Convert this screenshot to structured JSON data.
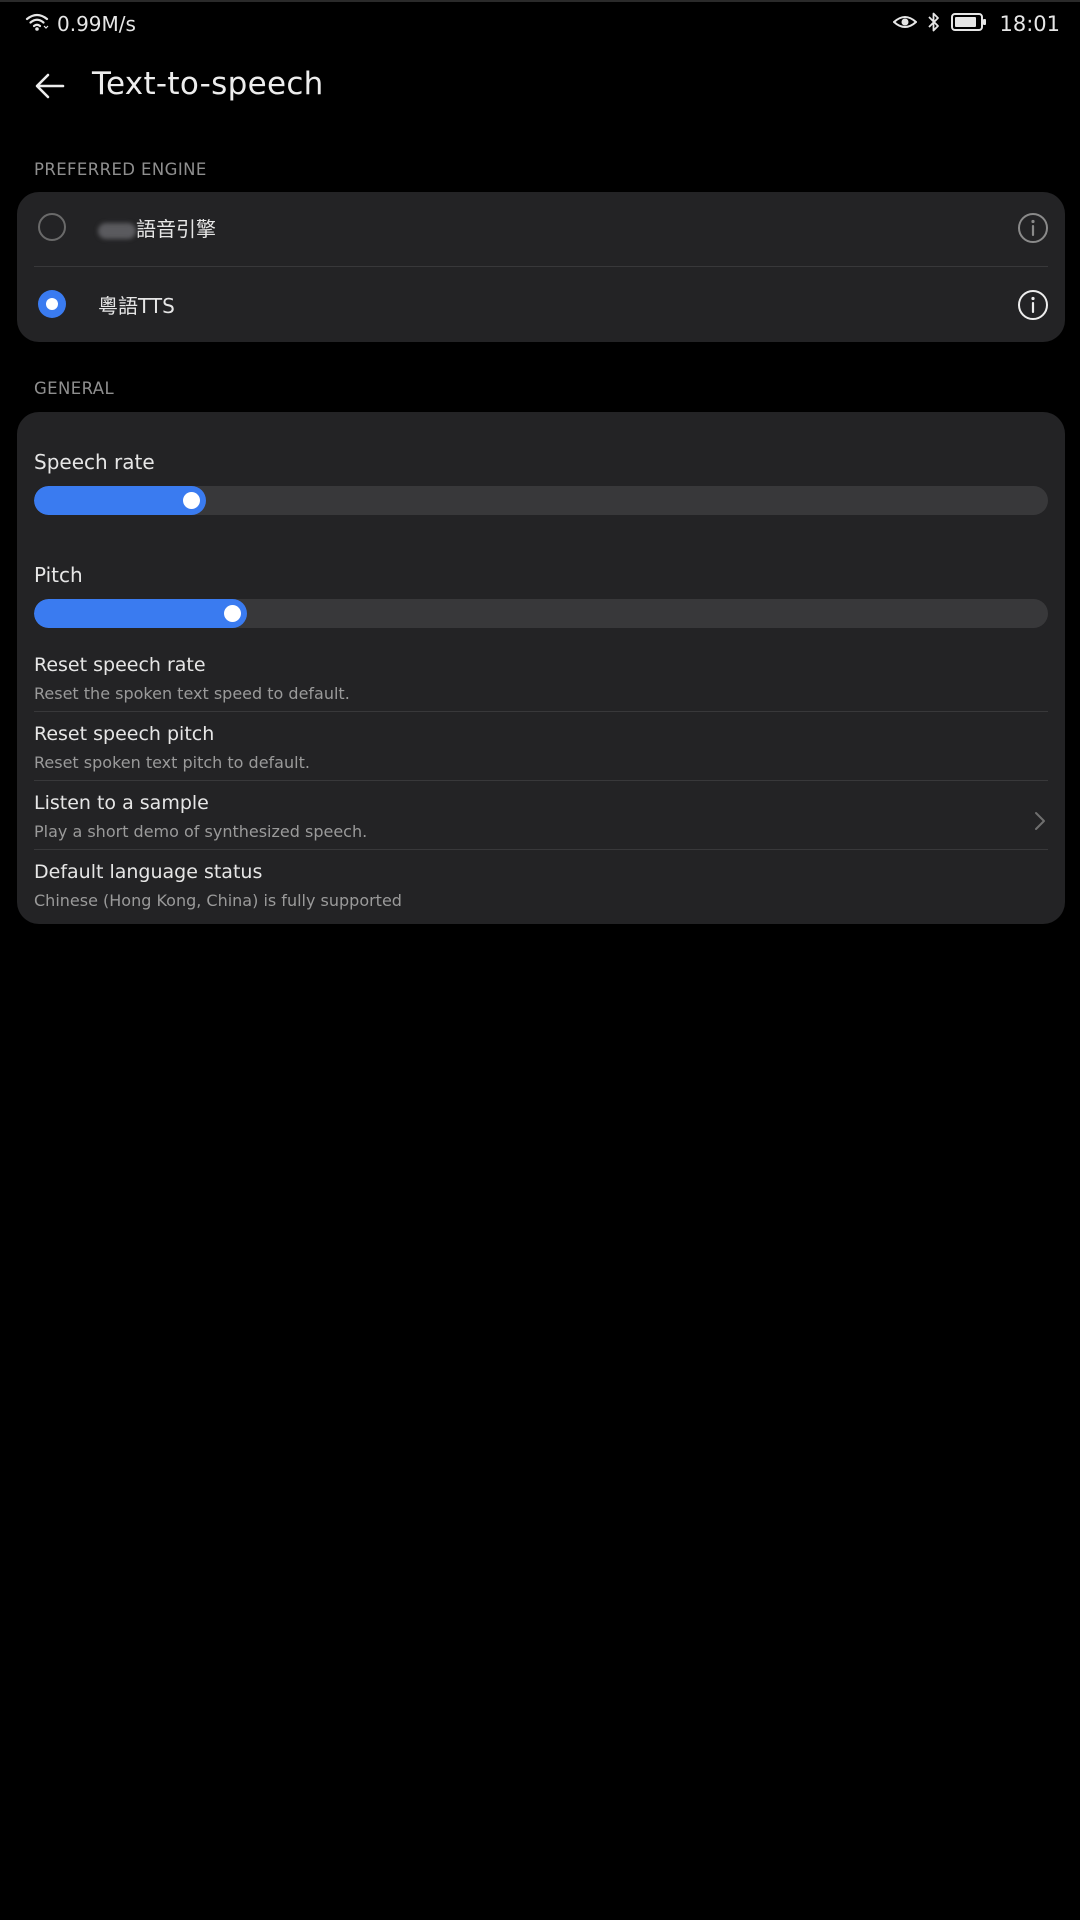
{
  "status_bar": {
    "speed": "0.99M/s",
    "time": "18:01",
    "icons": [
      "wifi-icon",
      "eye-icon",
      "bluetooth-icon",
      "battery-icon"
    ]
  },
  "header": {
    "title": "Text-to-speech",
    "back_icon": "back-arrow-icon"
  },
  "preferred_engine": {
    "section_label": "PREFERRED ENGINE",
    "engines": [
      {
        "label": "語音引擎",
        "selected": false,
        "label_partially_obscured": true
      },
      {
        "label": "粵語TTS",
        "selected": true
      }
    ]
  },
  "general": {
    "section_label": "GENERAL",
    "speech_rate": {
      "label": "Speech rate",
      "value_fraction": 0.17
    },
    "pitch": {
      "label": "Pitch",
      "value_fraction": 0.21
    },
    "items": [
      {
        "title": "Reset speech rate",
        "subtitle": "Reset the spoken text speed to default."
      },
      {
        "title": "Reset speech pitch",
        "subtitle": "Reset spoken text pitch to default."
      },
      {
        "title": "Listen to a sample",
        "subtitle": "Play a short demo of synthesized speech.",
        "has_chevron": true
      },
      {
        "title": "Default language status",
        "subtitle": "Chinese (Hong Kong, China) is fully supported"
      }
    ]
  },
  "colors": {
    "accent": "#3a7bf0",
    "background": "#000000",
    "card": "#232325"
  }
}
